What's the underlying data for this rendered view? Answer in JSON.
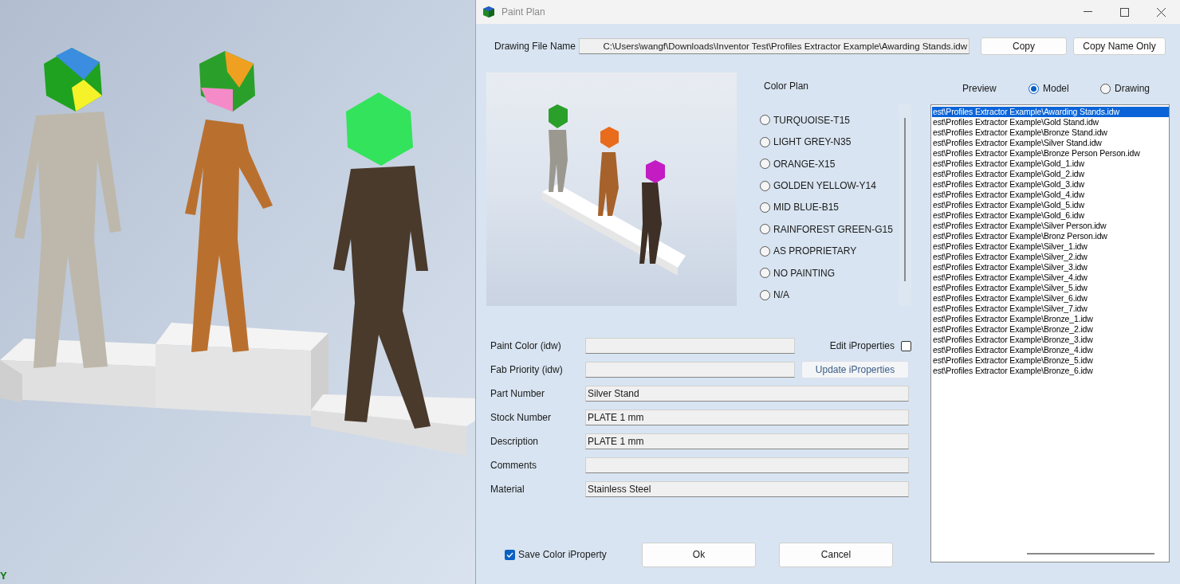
{
  "window": {
    "title": "Paint Plan"
  },
  "viewport": {
    "axis_label": "Y"
  },
  "drawing_file": {
    "label": "Drawing File Name",
    "value": "C:\\Users\\wangf\\Downloads\\Inventor Test\\Profiles Extractor Example\\Awarding Stands.idw",
    "buttons": [
      "Copy",
      "Copy Name Only"
    ]
  },
  "color_plan": {
    "label": "Color Plan",
    "options": [
      {
        "label": "TURQUOISE-T15",
        "selected": false
      },
      {
        "label": "LIGHT GREY-N35",
        "selected": false
      },
      {
        "label": "ORANGE-X15",
        "selected": false
      },
      {
        "label": "GOLDEN YELLOW-Y14",
        "selected": false
      },
      {
        "label": "MID BLUE-B15",
        "selected": false
      },
      {
        "label": "RAINFOREST GREEN-G15",
        "selected": false
      },
      {
        "label": "AS PROPRIETARY",
        "selected": false
      },
      {
        "label": "NO PAINTING",
        "selected": false
      },
      {
        "label": "N/A",
        "selected": false
      }
    ]
  },
  "preview": {
    "label": "Preview",
    "options": [
      {
        "label": "Model",
        "selected": true
      },
      {
        "label": "Drawing",
        "selected": false
      }
    ]
  },
  "files": [
    {
      "text": "est\\Profiles Extractor Example\\Awarding Stands.idw",
      "selected": true
    },
    {
      "text": "est\\Profiles Extractor Example\\Gold Stand.idw",
      "selected": false
    },
    {
      "text": "est\\Profiles Extractor Example\\Bronze Stand.idw",
      "selected": false
    },
    {
      "text": "est\\Profiles Extractor Example\\Silver Stand.idw",
      "selected": false
    },
    {
      "text": "est\\Profiles Extractor Example\\Bronze Person Person.idw",
      "selected": false
    },
    {
      "text": "est\\Profiles Extractor Example\\Gold_1.idw",
      "selected": false
    },
    {
      "text": "est\\Profiles Extractor Example\\Gold_2.idw",
      "selected": false
    },
    {
      "text": "est\\Profiles Extractor Example\\Gold_3.idw",
      "selected": false
    },
    {
      "text": "est\\Profiles Extractor Example\\Gold_4.idw",
      "selected": false
    },
    {
      "text": "est\\Profiles Extractor Example\\Gold_5.idw",
      "selected": false
    },
    {
      "text": "est\\Profiles Extractor Example\\Gold_6.idw",
      "selected": false
    },
    {
      "text": "est\\Profiles Extractor Example\\Silver Person.idw",
      "selected": false
    },
    {
      "text": "est\\Profiles Extractor Example\\Bronz Person.idw",
      "selected": false
    },
    {
      "text": "est\\Profiles Extractor Example\\Silver_1.idw",
      "selected": false
    },
    {
      "text": "est\\Profiles Extractor Example\\Silver_2.idw",
      "selected": false
    },
    {
      "text": "est\\Profiles Extractor Example\\Silver_3.idw",
      "selected": false
    },
    {
      "text": "est\\Profiles Extractor Example\\Silver_4.idw",
      "selected": false
    },
    {
      "text": "est\\Profiles Extractor Example\\Silver_5.idw",
      "selected": false
    },
    {
      "text": "est\\Profiles Extractor Example\\Silver_6.idw",
      "selected": false
    },
    {
      "text": "est\\Profiles Extractor Example\\Silver_7.idw",
      "selected": false
    },
    {
      "text": "est\\Profiles Extractor Example\\Bronze_1.idw",
      "selected": false
    },
    {
      "text": "est\\Profiles Extractor Example\\Bronze_2.idw",
      "selected": false
    },
    {
      "text": "est\\Profiles Extractor Example\\Bronze_3.idw",
      "selected": false
    },
    {
      "text": "est\\Profiles Extractor Example\\Bronze_4.idw",
      "selected": false
    },
    {
      "text": "est\\Profiles Extractor Example\\Bronze_5.idw",
      "selected": false
    },
    {
      "text": "est\\Profiles Extractor Example\\Bronze_6.idw",
      "selected": false
    }
  ],
  "fields": [
    {
      "label": "Paint Color (idw)"
    },
    {
      "label": "Fab Priority (idw)"
    },
    {
      "label": "Part Number",
      "value": "Silver Stand"
    },
    {
      "label": "Stock Number",
      "value": "PLATE 1 mm"
    },
    {
      "label": "Description",
      "value": "PLATE 1 mm"
    },
    {
      "label": "Comments"
    },
    {
      "label": "Material",
      "value": "Stainless Steel"
    }
  ],
  "edit_iproperties": {
    "label": "Edit iProperties",
    "checked": false
  },
  "update_button": "Update iProperties",
  "save_color": {
    "label": "Save Color iProperty",
    "checked": true
  },
  "buttons": [
    "Ok",
    "Cancel"
  ]
}
